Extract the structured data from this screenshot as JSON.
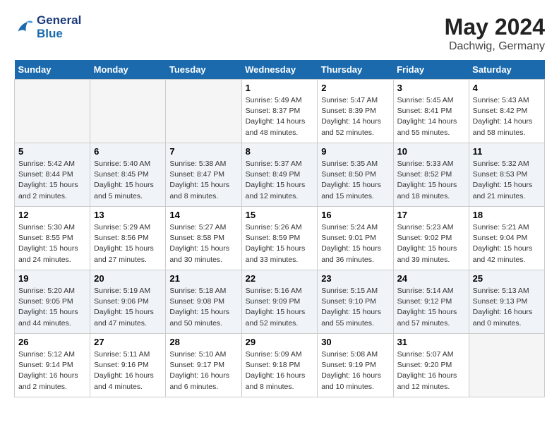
{
  "logo": {
    "line1": "General",
    "line2": "Blue"
  },
  "title": "May 2024",
  "location": "Dachwig, Germany",
  "days_header": [
    "Sunday",
    "Monday",
    "Tuesday",
    "Wednesday",
    "Thursday",
    "Friday",
    "Saturday"
  ],
  "weeks": [
    [
      {
        "num": "",
        "info": ""
      },
      {
        "num": "",
        "info": ""
      },
      {
        "num": "",
        "info": ""
      },
      {
        "num": "1",
        "info": "Sunrise: 5:49 AM\nSunset: 8:37 PM\nDaylight: 14 hours and 48 minutes."
      },
      {
        "num": "2",
        "info": "Sunrise: 5:47 AM\nSunset: 8:39 PM\nDaylight: 14 hours and 52 minutes."
      },
      {
        "num": "3",
        "info": "Sunrise: 5:45 AM\nSunset: 8:41 PM\nDaylight: 14 hours and 55 minutes."
      },
      {
        "num": "4",
        "info": "Sunrise: 5:43 AM\nSunset: 8:42 PM\nDaylight: 14 hours and 58 minutes."
      }
    ],
    [
      {
        "num": "5",
        "info": "Sunrise: 5:42 AM\nSunset: 8:44 PM\nDaylight: 15 hours and 2 minutes."
      },
      {
        "num": "6",
        "info": "Sunrise: 5:40 AM\nSunset: 8:45 PM\nDaylight: 15 hours and 5 minutes."
      },
      {
        "num": "7",
        "info": "Sunrise: 5:38 AM\nSunset: 8:47 PM\nDaylight: 15 hours and 8 minutes."
      },
      {
        "num": "8",
        "info": "Sunrise: 5:37 AM\nSunset: 8:49 PM\nDaylight: 15 hours and 12 minutes."
      },
      {
        "num": "9",
        "info": "Sunrise: 5:35 AM\nSunset: 8:50 PM\nDaylight: 15 hours and 15 minutes."
      },
      {
        "num": "10",
        "info": "Sunrise: 5:33 AM\nSunset: 8:52 PM\nDaylight: 15 hours and 18 minutes."
      },
      {
        "num": "11",
        "info": "Sunrise: 5:32 AM\nSunset: 8:53 PM\nDaylight: 15 hours and 21 minutes."
      }
    ],
    [
      {
        "num": "12",
        "info": "Sunrise: 5:30 AM\nSunset: 8:55 PM\nDaylight: 15 hours and 24 minutes."
      },
      {
        "num": "13",
        "info": "Sunrise: 5:29 AM\nSunset: 8:56 PM\nDaylight: 15 hours and 27 minutes."
      },
      {
        "num": "14",
        "info": "Sunrise: 5:27 AM\nSunset: 8:58 PM\nDaylight: 15 hours and 30 minutes."
      },
      {
        "num": "15",
        "info": "Sunrise: 5:26 AM\nSunset: 8:59 PM\nDaylight: 15 hours and 33 minutes."
      },
      {
        "num": "16",
        "info": "Sunrise: 5:24 AM\nSunset: 9:01 PM\nDaylight: 15 hours and 36 minutes."
      },
      {
        "num": "17",
        "info": "Sunrise: 5:23 AM\nSunset: 9:02 PM\nDaylight: 15 hours and 39 minutes."
      },
      {
        "num": "18",
        "info": "Sunrise: 5:21 AM\nSunset: 9:04 PM\nDaylight: 15 hours and 42 minutes."
      }
    ],
    [
      {
        "num": "19",
        "info": "Sunrise: 5:20 AM\nSunset: 9:05 PM\nDaylight: 15 hours and 44 minutes."
      },
      {
        "num": "20",
        "info": "Sunrise: 5:19 AM\nSunset: 9:06 PM\nDaylight: 15 hours and 47 minutes."
      },
      {
        "num": "21",
        "info": "Sunrise: 5:18 AM\nSunset: 9:08 PM\nDaylight: 15 hours and 50 minutes."
      },
      {
        "num": "22",
        "info": "Sunrise: 5:16 AM\nSunset: 9:09 PM\nDaylight: 15 hours and 52 minutes."
      },
      {
        "num": "23",
        "info": "Sunrise: 5:15 AM\nSunset: 9:10 PM\nDaylight: 15 hours and 55 minutes."
      },
      {
        "num": "24",
        "info": "Sunrise: 5:14 AM\nSunset: 9:12 PM\nDaylight: 15 hours and 57 minutes."
      },
      {
        "num": "25",
        "info": "Sunrise: 5:13 AM\nSunset: 9:13 PM\nDaylight: 16 hours and 0 minutes."
      }
    ],
    [
      {
        "num": "26",
        "info": "Sunrise: 5:12 AM\nSunset: 9:14 PM\nDaylight: 16 hours and 2 minutes."
      },
      {
        "num": "27",
        "info": "Sunrise: 5:11 AM\nSunset: 9:16 PM\nDaylight: 16 hours and 4 minutes."
      },
      {
        "num": "28",
        "info": "Sunrise: 5:10 AM\nSunset: 9:17 PM\nDaylight: 16 hours and 6 minutes."
      },
      {
        "num": "29",
        "info": "Sunrise: 5:09 AM\nSunset: 9:18 PM\nDaylight: 16 hours and 8 minutes."
      },
      {
        "num": "30",
        "info": "Sunrise: 5:08 AM\nSunset: 9:19 PM\nDaylight: 16 hours and 10 minutes."
      },
      {
        "num": "31",
        "info": "Sunrise: 5:07 AM\nSunset: 9:20 PM\nDaylight: 16 hours and 12 minutes."
      },
      {
        "num": "",
        "info": ""
      }
    ]
  ]
}
